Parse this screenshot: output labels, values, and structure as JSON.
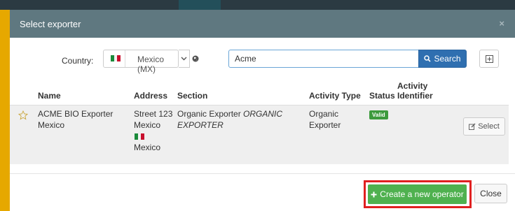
{
  "dialog": {
    "title": "Select exporter",
    "close_glyph": "×"
  },
  "search": {
    "country_label": "Country:",
    "country_value": "Mexico (MX)",
    "query": "Acme",
    "search_label": "Search"
  },
  "table": {
    "columns": {
      "name": "Name",
      "address": "Address",
      "section": "Section",
      "activity_type": "Activity Type",
      "status": "Status",
      "activity_identifier_1": "Activity",
      "activity_identifier_2": "Identifier"
    },
    "rows": [
      {
        "name_1": "ACME BIO Exporter",
        "name_2": "Mexico",
        "address_street": "Street 123",
        "address_city": "Mexico",
        "address_country": "Mexico",
        "section_plain": "Organic Exporter ",
        "section_italic_1": "ORGANIC",
        "section_italic_2": "EXPORTER",
        "activity_type_1": "Organic",
        "activity_type_2": "Exporter",
        "status": "Valid",
        "select_label": "Select"
      }
    ]
  },
  "footer": {
    "create_label": "Create a new operator",
    "close_label": "Close"
  },
  "colors": {
    "header_bg": "#5f7880",
    "search_button": "#2f6fb0",
    "create_button": "#4fb14f",
    "valid_badge": "#3c9a3c",
    "highlight": "#e02020",
    "backdrop": "#f5b800"
  },
  "icons": [
    "flag-mexico-icon",
    "chevron-down-icon",
    "globe-icon",
    "search-icon",
    "expand-icon",
    "star-icon",
    "edit-icon",
    "plus-icon"
  ]
}
